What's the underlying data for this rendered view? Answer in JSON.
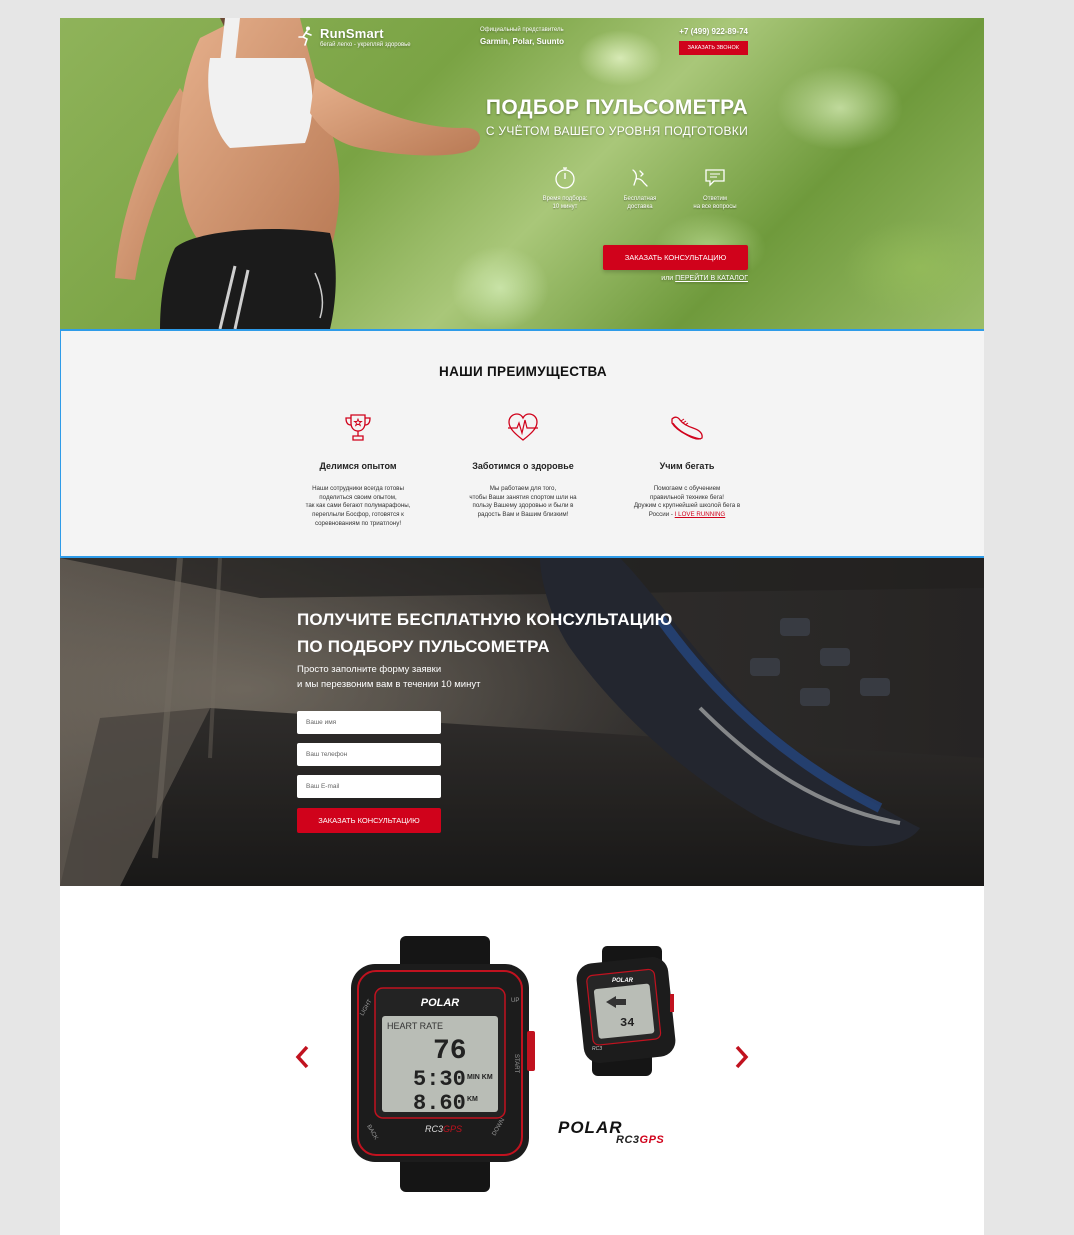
{
  "header": {
    "logo_title": "RunSmart",
    "logo_sub": "бегай легко - укрепляй здоровье",
    "rep_sub": "Официальный представитель",
    "rep_brands": "Garmin, Polar, Suunto",
    "phone": "+7 (499) 922-89-74",
    "callback_label": "ЗАКАЗАТЬ ЗВОНОК"
  },
  "hero": {
    "title": "ПОДБОР ПУЛЬСОМЕТРА",
    "subtitle": "С УЧЁТОМ ВАШЕГО УРОВНЯ ПОДГОТОВКИ",
    "features": [
      {
        "line1": "Время подбора:",
        "line2": "10 минут",
        "icon": "stopwatch-icon"
      },
      {
        "line1": "Бесплатная",
        "line2": "доставка",
        "icon": "delivery-icon"
      },
      {
        "line1": "Ответим",
        "line2": "на все вопросы",
        "icon": "chat-icon"
      }
    ],
    "consult_label": "ЗАКАЗАТЬ КОНСУЛЬТАЦИЮ",
    "catalog_prefix": "или",
    "catalog_link": "ПЕРЕЙТИ В КАТАЛОГ"
  },
  "advantages": {
    "title": "НАШИ ПРЕИМУЩЕСТВА",
    "items": [
      {
        "name": "Делимся опытом",
        "icon": "trophy-icon",
        "desc": [
          "Наши сотрудники всегда готовы",
          "поделиться своим опытом,",
          "так как сами бегают полумарафоны,",
          "переплыли Босфор, готовятся к",
          "соревнованиям по триатлону!"
        ]
      },
      {
        "name": "Заботимся о здоровье",
        "icon": "heart-pulse-icon",
        "desc": [
          "Мы работаем для того,",
          "чтобы Ваши занятия спортом шли на",
          "пользу Вашему здоровью и были в",
          "радость Вам и Вашим близким!"
        ]
      },
      {
        "name": "Учим бегать",
        "icon": "sneaker-icon",
        "desc": [
          "Помогаем с обучением",
          "правильной технике бега!",
          "Дружим с крупнейшей школой бега в",
          "России -"
        ],
        "link": "I LOVE RUNNING"
      }
    ]
  },
  "consult": {
    "title1": "ПОЛУЧИТЕ БЕСПЛАТНУЮ КОНСУЛЬТАЦИЮ",
    "title2": "ПО ПОДБОРУ ПУЛЬСОМЕТРА",
    "sub1": "Просто заполните форму заявки",
    "sub2": "и мы перезвоним вам в течении 10 минут",
    "name_placeholder": "Ваше имя",
    "phone_placeholder": "Ваш телефон",
    "email_placeholder": "Ваш E-mail",
    "submit_label": "ЗАКАЗАТЬ КОНСУЛЬТАЦИЮ"
  },
  "carousel": {
    "brand": "POLAR",
    "model_prefix": "RC3",
    "model_suffix": "GPS",
    "watch": {
      "brand": "POLAR",
      "screen_label": "HEART RATE",
      "hr": "76",
      "pace": "5:30",
      "pace_unit": "MIN KM",
      "distance": "8.60",
      "distance_unit": "KM",
      "model": "RC3",
      "model_suffix": "GPS",
      "btn_light": "LIGHT",
      "btn_up": "UP",
      "btn_start": "START",
      "btn_back": "BACK",
      "btn_down": "DOWN"
    },
    "watch_small": {
      "brand": "POLAR",
      "value": "34",
      "model": "RC3"
    },
    "colors": {
      "accent": "#d0021b"
    }
  }
}
